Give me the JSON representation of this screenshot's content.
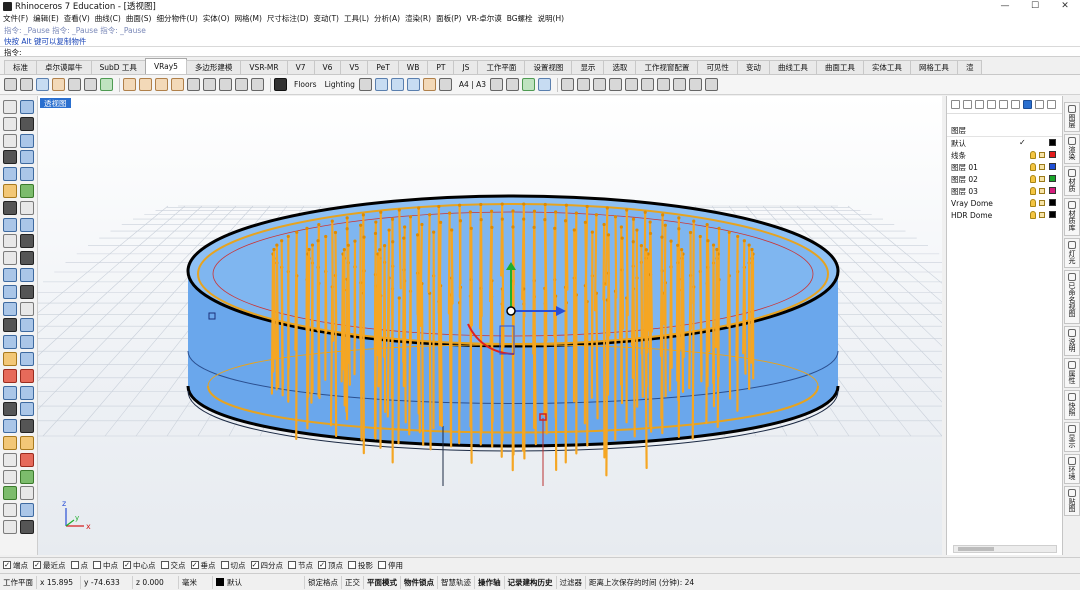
{
  "window": {
    "title": "Rhinoceros 7 Education - [透视图]",
    "controls": [
      "—",
      "☐",
      "✕"
    ]
  },
  "menu": [
    "文件(F)",
    "编辑(E)",
    "查看(V)",
    "曲线(C)",
    "曲面(S)",
    "细分物件(U)",
    "实体(O)",
    "网格(M)",
    "尺寸标注(D)",
    "变动(T)",
    "工具(L)",
    "分析(A)",
    "渲染(R)",
    "面板(P)",
    "VR-卓尔谟",
    "BG螺栓",
    "说明(H)"
  ],
  "command": {
    "history": "指令: _Pause 指令: _Pause 指令: _Pause",
    "hint": "快按 Alt 键可以复制物件",
    "prompt_label": "指令:",
    "input_value": ""
  },
  "tabs": [
    "标准",
    "卓尔谟犀牛",
    "SubD 工具",
    "VRay5",
    "多边形建模",
    "VSR-MR",
    "V7",
    "V6",
    "V5",
    "PeT",
    "WB",
    "PT",
    "JS",
    "工作平面",
    "设置视图",
    "显示",
    "选取",
    "工作视窗配置",
    "可见性",
    "变动",
    "曲线工具",
    "曲面工具",
    "实体工具",
    "网格工具",
    "渲"
  ],
  "active_tab_index": 3,
  "toolbar": {
    "floors_label": "Floors",
    "lighting_label": "Lighting",
    "paper_label": "A4 | A3"
  },
  "viewport": {
    "label": "透视图",
    "axis_x": "x",
    "axis_y": "y",
    "axis_z": "z"
  },
  "layers": {
    "header": "图层",
    "rows": [
      {
        "name": "默认",
        "current": true,
        "color": "#000000"
      },
      {
        "name": "线条",
        "current": false,
        "color": "#e31b1b"
      },
      {
        "name": "图层 01",
        "current": false,
        "color": "#1f4fd6"
      },
      {
        "name": "图层 02",
        "current": false,
        "color": "#18a52a"
      },
      {
        "name": "图层 03",
        "current": false,
        "color": "#d61c7c"
      },
      {
        "name": "Vray Dome",
        "current": false,
        "color": "#000000"
      },
      {
        "name": "HDR Dome",
        "current": false,
        "color": "#000000"
      }
    ],
    "current_mark": "✓"
  },
  "side_tabs": [
    "图层",
    "渲染",
    "材质",
    "材质库",
    "灯光",
    "已命名视图",
    "说明",
    "属性",
    "快照",
    "显示",
    "环境",
    "贴图"
  ],
  "osnaps": [
    {
      "label": "端点",
      "checked": true
    },
    {
      "label": "最近点",
      "checked": true
    },
    {
      "label": "点",
      "checked": false
    },
    {
      "label": "中点",
      "checked": false
    },
    {
      "label": "中心点",
      "checked": true
    },
    {
      "label": "交点",
      "checked": false
    },
    {
      "label": "垂点",
      "checked": true
    },
    {
      "label": "切点",
      "checked": false
    },
    {
      "label": "四分点",
      "checked": true
    },
    {
      "label": "节点",
      "checked": false
    },
    {
      "label": "顶点",
      "checked": true
    },
    {
      "label": "投影",
      "checked": false
    },
    {
      "label": "停用",
      "checked": false
    }
  ],
  "status": {
    "cplane": "工作平面",
    "x": "x 15.895",
    "y": "y -74.633",
    "z": "z 0.000",
    "units": "毫米",
    "layer": "默认",
    "toggles": [
      "锁定格点",
      "正交",
      "平面模式",
      "物件锁点",
      "智慧轨迹",
      "操作轴",
      "记录建构历史",
      "过滤器"
    ],
    "bold_toggles": [
      2,
      3,
      5,
      6
    ],
    "autosave": "距离上次保存的时间 (分钟): 24"
  }
}
